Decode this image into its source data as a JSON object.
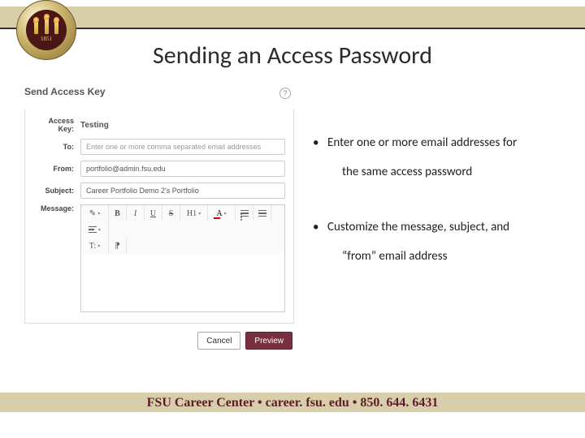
{
  "header": {
    "seal_year": "1851"
  },
  "title": "Sending an Access Password",
  "form": {
    "header": "Send Access Key",
    "access_key_label": "Access Key:",
    "access_key_value": "Testing",
    "to_label": "To:",
    "to_placeholder": "Enter one or more comma separated email addresses",
    "from_label": "From:",
    "from_value": "portfolio@admin.fsu.edu",
    "subject_label": "Subject:",
    "subject_value": "Career Portfolio Demo 2's Portfolio",
    "message_label": "Message:",
    "toolbar": {
      "format": "✎",
      "bold": "B",
      "italic": "I",
      "underline": "U",
      "strike": "S",
      "heading": "H1",
      "fontcolor": "A",
      "para": "T:",
      "embed": "⁋"
    },
    "cancel": "Cancel",
    "preview": "Preview"
  },
  "bullets": {
    "b1a": "Enter one or more email addresses for",
    "b1b": "the same access password",
    "b2a": "Customize the message, subject, and",
    "b2b": "“from” email address"
  },
  "footer": "FSU Career Center • career. fsu. edu • 850. 644. 6431"
}
